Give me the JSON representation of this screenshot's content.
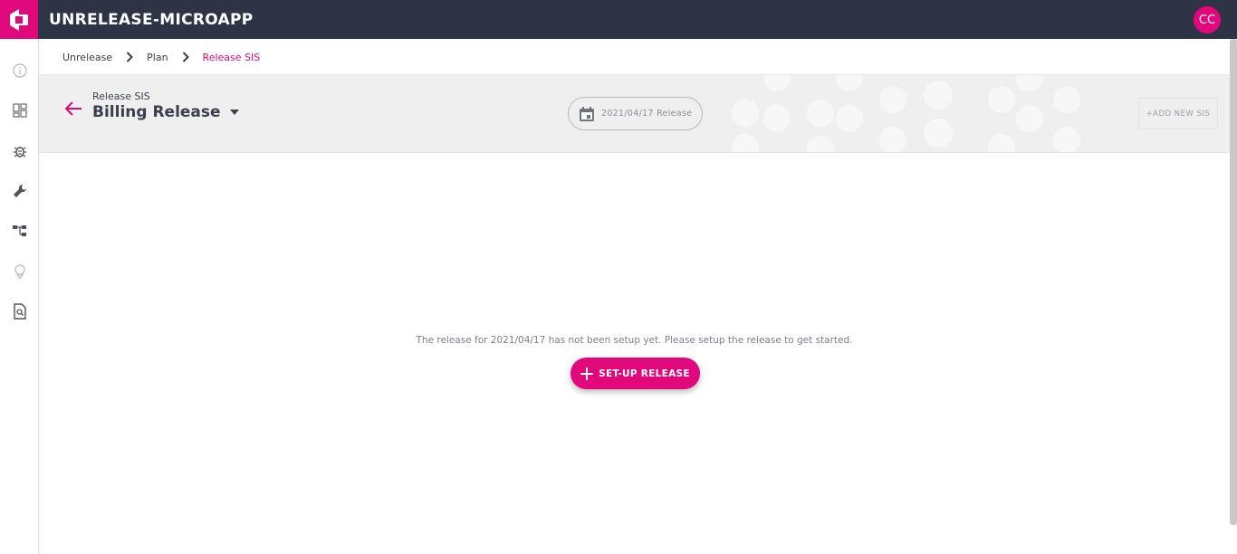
{
  "app": {
    "title": "UNRELEASE-MICROAPP",
    "avatar_initials": "CC",
    "accent": "#e0087a",
    "topbar_color": "#2e3445"
  },
  "sidebar": {
    "items": [
      {
        "icon": "info-icon"
      },
      {
        "icon": "dashboard-icon"
      },
      {
        "icon": "bug-icon"
      },
      {
        "icon": "wrench-icon"
      },
      {
        "icon": "hierarchy-icon"
      },
      {
        "icon": "lightbulb-icon"
      },
      {
        "icon": "document-search-icon"
      }
    ]
  },
  "breadcrumb": {
    "items": [
      "Unrelease",
      "Plan",
      "Release SIS"
    ]
  },
  "header": {
    "subtitle": "Release SIS",
    "title": "Billing Release",
    "date_label": "2021/04/17 Release",
    "add_button": "+ADD NEW SIS"
  },
  "main": {
    "empty_message": "The release for 2021/04/17 has not been setup yet. Please setup the release to get started.",
    "setup_button": "SET-UP RELEASE"
  }
}
